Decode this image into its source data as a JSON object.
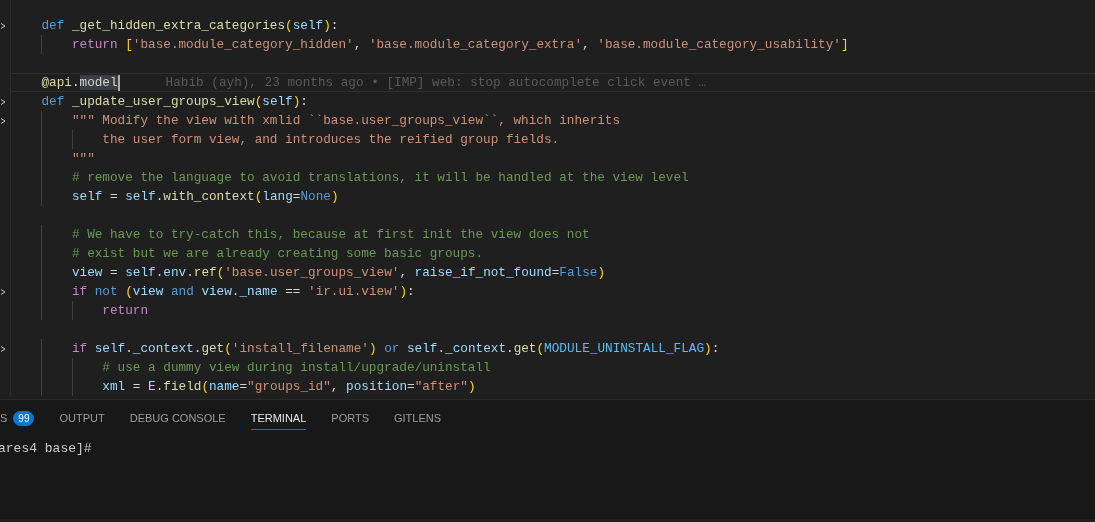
{
  "editor": {
    "lines": [
      {
        "foldable": false
      },
      {
        "foldable": true,
        "tokens": [
          {
            "text": "    def",
            "kind": "kw"
          },
          {
            "text": " _get_hidden_extra_categories",
            "kind": "fn"
          },
          {
            "text": "(",
            "kind": "br"
          },
          {
            "text": "self",
            "kind": "var"
          },
          {
            "text": ")",
            "kind": "br"
          },
          {
            "text": ":",
            "kind": "op"
          }
        ]
      },
      {
        "foldable": false,
        "tokens": [
          {
            "text": "        return",
            "kind": "ctrl"
          },
          {
            "text": " [",
            "kind": "br"
          },
          {
            "text": "'base.module_category_hidden'",
            "kind": "str"
          },
          {
            "text": ", ",
            "kind": "op"
          },
          {
            "text": "'base.module_category_extra'",
            "kind": "str"
          },
          {
            "text": ", ",
            "kind": "op"
          },
          {
            "text": "'base.module_category_usability'",
            "kind": "str"
          },
          {
            "text": "]",
            "kind": "br"
          }
        ]
      },
      {
        "foldable": false
      },
      {
        "foldable": false,
        "current": true,
        "blame": "Habib (ayh), 23 months ago • [IMP] web: stop autocomplete click event …",
        "tokens": [
          {
            "text": "    @api.",
            "kind": "fn"
          },
          {
            "text": "model",
            "kind": "match"
          }
        ]
      },
      {
        "foldable": true,
        "tokens": [
          {
            "text": "    def",
            "kind": "kw"
          },
          {
            "text": " _update_user_groups_view",
            "kind": "fn"
          },
          {
            "text": "(",
            "kind": "br"
          },
          {
            "text": "self",
            "kind": "var"
          },
          {
            "text": ")",
            "kind": "br"
          },
          {
            "text": ":",
            "kind": "op"
          }
        ]
      },
      {
        "foldable": true,
        "tokens": [
          {
            "text": "        \"\"\" Modify the view with xmlid ``base.user_groups_view``, which inherits",
            "kind": "str"
          }
        ]
      },
      {
        "foldable": false,
        "tokens": [
          {
            "text": "            the user form view, and introduces the reified group fields.",
            "kind": "str"
          }
        ]
      },
      {
        "foldable": false,
        "tokens": [
          {
            "text": "        \"\"\"",
            "kind": "str"
          }
        ]
      },
      {
        "foldable": false,
        "tokens": [
          {
            "text": "        # remove the language to avoid translations, it will be handled at the view level",
            "kind": "com"
          }
        ]
      },
      {
        "foldable": false,
        "tokens": [
          {
            "text": "        self",
            "kind": "var"
          },
          {
            "text": " = ",
            "kind": "op"
          },
          {
            "text": "self",
            "kind": "var"
          },
          {
            "text": ".",
            "kind": "op"
          },
          {
            "text": "with_context",
            "kind": "fn"
          },
          {
            "text": "(",
            "kind": "br"
          },
          {
            "text": "lang",
            "kind": "var"
          },
          {
            "text": "=",
            "kind": "op"
          },
          {
            "text": "None",
            "kind": "kw"
          },
          {
            "text": ")",
            "kind": "br"
          }
        ]
      },
      {
        "foldable": false
      },
      {
        "foldable": false,
        "tokens": [
          {
            "text": "        # We have to try-catch this, because at first init the view does not",
            "kind": "com"
          }
        ]
      },
      {
        "foldable": false,
        "tokens": [
          {
            "text": "        # exist but we are already creating some basic groups.",
            "kind": "com"
          }
        ]
      },
      {
        "foldable": false,
        "tokens": [
          {
            "text": "        view",
            "kind": "var"
          },
          {
            "text": " = ",
            "kind": "op"
          },
          {
            "text": "self",
            "kind": "var"
          },
          {
            "text": ".",
            "kind": "op"
          },
          {
            "text": "env",
            "kind": "var"
          },
          {
            "text": ".",
            "kind": "op"
          },
          {
            "text": "ref",
            "kind": "fn"
          },
          {
            "text": "(",
            "kind": "br"
          },
          {
            "text": "'base.user_groups_view'",
            "kind": "str"
          },
          {
            "text": ", ",
            "kind": "op"
          },
          {
            "text": "raise_if_not_found",
            "kind": "var"
          },
          {
            "text": "=",
            "kind": "op"
          },
          {
            "text": "False",
            "kind": "kw"
          },
          {
            "text": ")",
            "kind": "br"
          }
        ]
      },
      {
        "foldable": true,
        "tokens": [
          {
            "text": "        if",
            "kind": "ctrl"
          },
          {
            "text": " not",
            "kind": "kw"
          },
          {
            "text": " (",
            "kind": "br"
          },
          {
            "text": "view",
            "kind": "var"
          },
          {
            "text": " and",
            "kind": "kw"
          },
          {
            "text": " view",
            "kind": "var"
          },
          {
            "text": ".",
            "kind": "op"
          },
          {
            "text": "_name",
            "kind": "var"
          },
          {
            "text": " == ",
            "kind": "op"
          },
          {
            "text": "'ir.ui.view'",
            "kind": "str"
          },
          {
            "text": ")",
            "kind": "br"
          },
          {
            "text": ":",
            "kind": "op"
          }
        ]
      },
      {
        "foldable": false,
        "tokens": [
          {
            "text": "            return",
            "kind": "ctrl"
          }
        ]
      },
      {
        "foldable": false
      },
      {
        "foldable": true,
        "tokens": [
          {
            "text": "        if",
            "kind": "ctrl"
          },
          {
            "text": " self",
            "kind": "var"
          },
          {
            "text": ".",
            "kind": "op"
          },
          {
            "text": "_context",
            "kind": "var"
          },
          {
            "text": ".",
            "kind": "op"
          },
          {
            "text": "get",
            "kind": "fn"
          },
          {
            "text": "(",
            "kind": "br"
          },
          {
            "text": "'install_filename'",
            "kind": "str"
          },
          {
            "text": ")",
            "kind": "br"
          },
          {
            "text": " or",
            "kind": "kw"
          },
          {
            "text": " self",
            "kind": "var"
          },
          {
            "text": ".",
            "kind": "op"
          },
          {
            "text": "_context",
            "kind": "var"
          },
          {
            "text": ".",
            "kind": "op"
          },
          {
            "text": "get",
            "kind": "fn"
          },
          {
            "text": "(",
            "kind": "br"
          },
          {
            "text": "MODULE_UNINSTALL_FLAG",
            "kind": "const"
          },
          {
            "text": ")",
            "kind": "br"
          },
          {
            "text": ":",
            "kind": "op"
          }
        ]
      },
      {
        "foldable": false,
        "tokens": [
          {
            "text": "            # use a dummy view during install/upgrade/uninstall",
            "kind": "com"
          }
        ]
      },
      {
        "foldable": false,
        "tokens": [
          {
            "text": "            xml",
            "kind": "var"
          },
          {
            "text": " = ",
            "kind": "op"
          },
          {
            "text": "E",
            "kind": "var"
          },
          {
            "text": ".",
            "kind": "op"
          },
          {
            "text": "field",
            "kind": "fn"
          },
          {
            "text": "(",
            "kind": "br"
          },
          {
            "text": "name",
            "kind": "var"
          },
          {
            "text": "=",
            "kind": "op"
          },
          {
            "text": "\"groups_id\"",
            "kind": "str"
          },
          {
            "text": ", ",
            "kind": "op"
          },
          {
            "text": "position",
            "kind": "var"
          },
          {
            "text": "=",
            "kind": "op"
          },
          {
            "text": "\"after\"",
            "kind": "str"
          },
          {
            "text": ")",
            "kind": "br"
          }
        ]
      }
    ]
  },
  "panel": {
    "tabs": [
      {
        "label": "S",
        "badge": "99",
        "selected": false
      },
      {
        "label": "OUTPUT",
        "selected": false
      },
      {
        "label": "DEBUG CONSOLE",
        "selected": false
      },
      {
        "label": "TERMINAL",
        "selected": true
      },
      {
        "label": "PORTS",
        "selected": false
      },
      {
        "label": "GITLENS",
        "selected": false
      }
    ],
    "terminal": {
      "prompt": "ares4 base]#"
    }
  }
}
